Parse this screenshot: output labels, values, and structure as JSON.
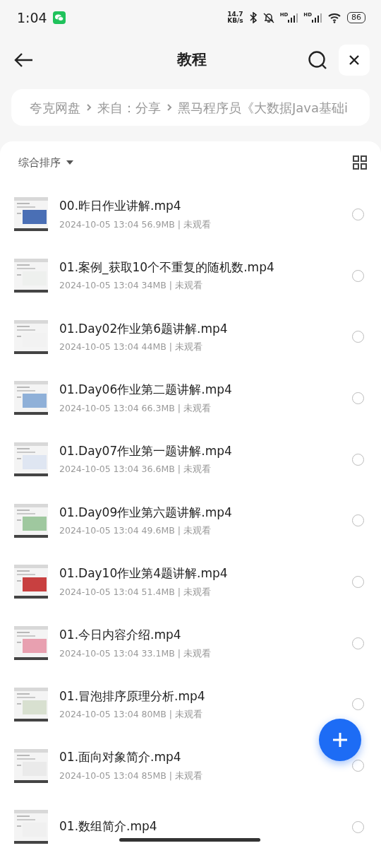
{
  "status_bar": {
    "time": "1:04",
    "speed_value": "14.7",
    "speed_unit": "KB/s",
    "signal_labels": [
      "HD",
      "HD"
    ],
    "battery": "86"
  },
  "header": {
    "title": "教程"
  },
  "breadcrumb": [
    "夸克网盘",
    "来自：分享",
    "黑马程序员《大数据Java基础i"
  ],
  "sort": {
    "label": "综合排序"
  },
  "files": [
    {
      "name": "00.昨日作业讲解.mp4",
      "meta": "2024-10-05 13:04  56.9MB | 未观看",
      "selected": false
    },
    {
      "name": "01.案例_获取10个不重复的随机数.mp4",
      "meta": "2024-10-05 13:04  34MB | 未观看",
      "selected": false
    },
    {
      "name": "01.Day02作业第6题讲解.mp4",
      "meta": "2024-10-05 13:04  44MB | 未观看",
      "selected": false
    },
    {
      "name": "01.Day06作业第二题讲解.mp4",
      "meta": "2024-10-05 13:04  66.3MB | 未观看",
      "selected": false
    },
    {
      "name": "01.Day07作业第一题讲解.mp4",
      "meta": "2024-10-05 13:04  36.6MB | 未观看",
      "selected": false
    },
    {
      "name": "01.Day09作业第六题讲解.mp4",
      "meta": "2024-10-05 13:04  49.6MB | 未观看",
      "selected": false
    },
    {
      "name": "01.Day10作业第4题讲解.mp4",
      "meta": "2024-10-05 13:04  51.4MB | 未观看",
      "selected": false
    },
    {
      "name": "01.今日内容介绍.mp4",
      "meta": "2024-10-05 13:04  33.1MB | 未观看",
      "selected": false
    },
    {
      "name": "01.冒泡排序原理分析.mp4",
      "meta": "2024-10-05 13:04  80MB | 未观看",
      "selected": false
    },
    {
      "name": "01.面向对象简介.mp4",
      "meta": "2024-10-05 13:04  85MB | 未观看",
      "selected": false
    },
    {
      "name": "01.数组简介.mp4",
      "selected": false
    }
  ]
}
